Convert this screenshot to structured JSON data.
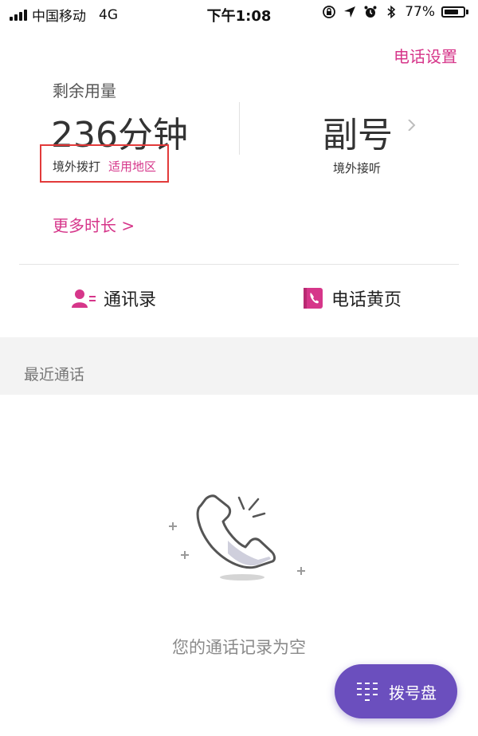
{
  "status_bar": {
    "carrier": "中国移动",
    "network": "4G",
    "time": "下午1:08",
    "battery": "77%",
    "battery_level": 0.77
  },
  "header": {
    "settings_link": "电话设置"
  },
  "usage": {
    "title": "剩余用量",
    "minutes": "236分钟",
    "overseas_call": "境外拨打",
    "applicable_region": "适用地区",
    "more_duration": "更多时长 >"
  },
  "secondary_number": {
    "title": "副号",
    "subtitle": "境外接听"
  },
  "quick_actions": {
    "contacts": "通讯录",
    "yellow_pages": "电话黄页"
  },
  "recent": {
    "title": "最近通话",
    "empty_text": "您的通话记录为空"
  },
  "dialpad": {
    "label": "拨号盘"
  },
  "colors": {
    "accent": "#d6368a",
    "dialpad_bg": "#6b4fbe",
    "highlight_box": "#e23a3a"
  },
  "icons": {
    "contacts": "contacts-icon",
    "yellow_pages": "phone-book-icon",
    "chevron": "chevron-right-icon",
    "dialpad": "dialpad-icon",
    "empty": "phone-handset-icon"
  }
}
